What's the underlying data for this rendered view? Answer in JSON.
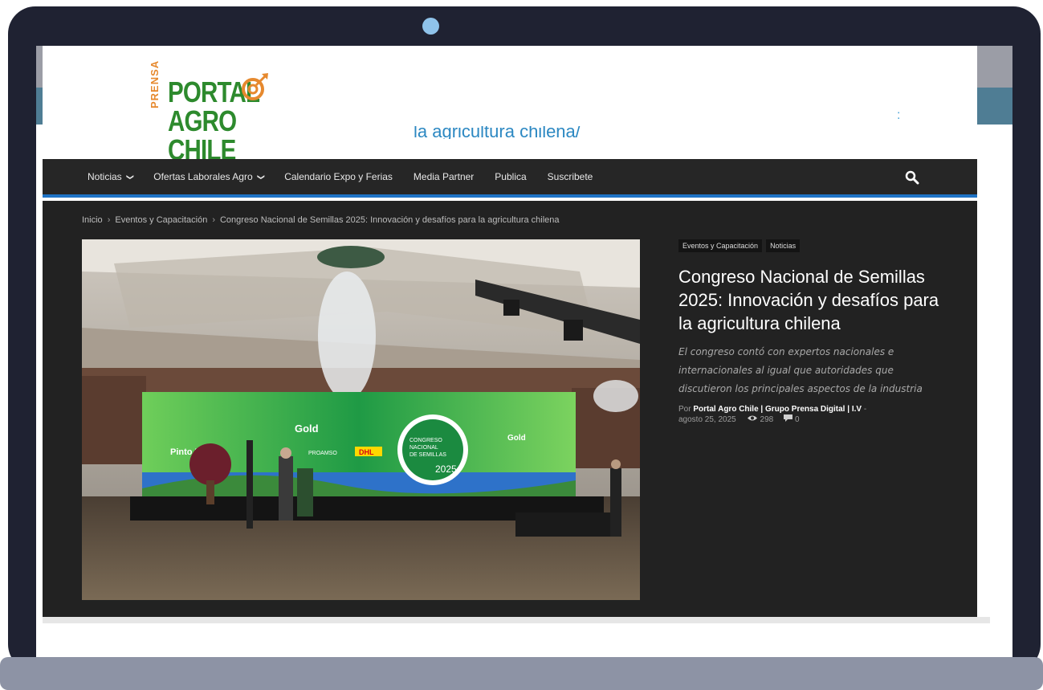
{
  "header": {
    "logo": {
      "prefix": "PRENSA",
      "line1": "PORTAL",
      "line2": "AGRO CHILE"
    },
    "link_text": "la agricultura chilena/",
    "colon_mark": ":"
  },
  "nav": {
    "items": [
      {
        "label": "Noticias",
        "dropdown": true
      },
      {
        "label": "Ofertas Laborales Agro",
        "dropdown": true
      },
      {
        "label": "Calendario Expo y Ferias",
        "dropdown": false
      },
      {
        "label": "Media Partner",
        "dropdown": false
      },
      {
        "label": "Publica",
        "dropdown": false
      },
      {
        "label": "Suscribete",
        "dropdown": false
      }
    ],
    "caret": "❯",
    "search_icon": "search-icon"
  },
  "breadcrumb": {
    "items": [
      "Inicio",
      "Eventos y Capacitación",
      "Congreso Nacional de Semillas 2025: Innovación y desafíos para la agricultura chilena"
    ],
    "separator": "›"
  },
  "hero": {
    "screen_left_word": "Gold",
    "screen_right_word": "Gold",
    "sponsor_1": "Pinto Piña",
    "sponsor_2": "DHL",
    "sponsor_3": "PROAMSO",
    "center_line1": "CONGRESO",
    "center_line2": "NACIONAL",
    "center_line3": "DE SEMILLAS",
    "center_year": "2025"
  },
  "article": {
    "tags": [
      "Eventos y Capacitación",
      "Noticias"
    ],
    "title": "Congreso Nacional de Semillas 2025: Innovación y desafíos para la agricultura chilena",
    "excerpt": "El congreso contó con expertos nacionales e internacionales al igual que autoridades que discutieron los principales aspectos de la industria",
    "meta": {
      "by": "Por",
      "author": "Portal Agro Chile | Grupo Prensa Digital | I.V",
      "dash": "-",
      "date": "agosto 25, 2025",
      "views": "298",
      "comments": "0"
    }
  },
  "colors": {
    "nav_bg": "#262626",
    "nav_accent": "#1e73c6",
    "content_bg": "#222222",
    "logo_green": "#2d8a2d",
    "logo_orange": "#e6892e",
    "link_blue": "#2c88c2"
  }
}
